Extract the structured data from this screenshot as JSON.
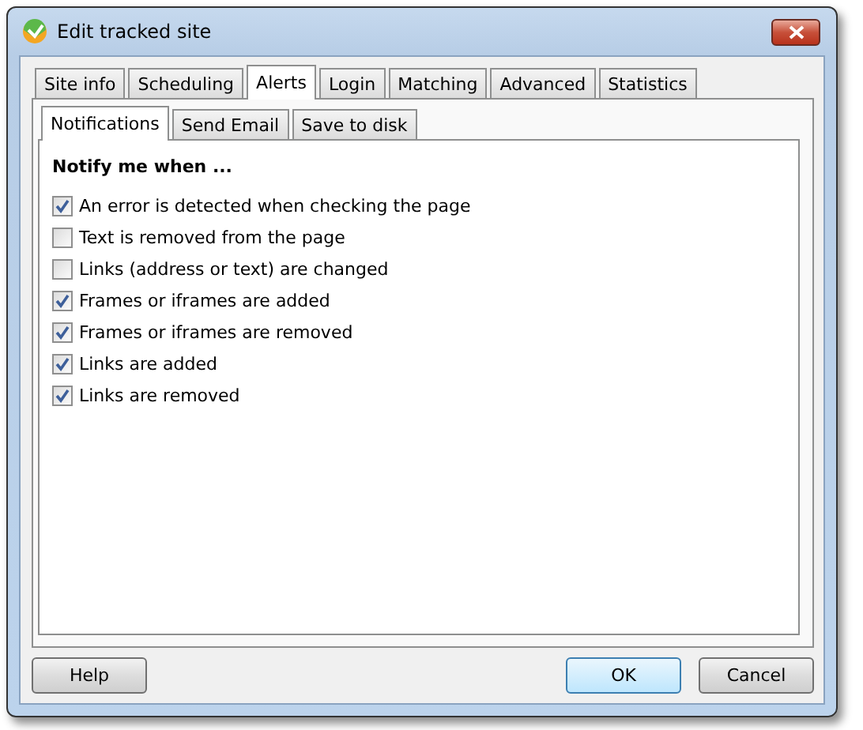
{
  "window": {
    "title": "Edit tracked site"
  },
  "tabs": [
    {
      "label": "Site info",
      "selected": false
    },
    {
      "label": "Scheduling",
      "selected": false
    },
    {
      "label": "Alerts",
      "selected": true
    },
    {
      "label": "Login",
      "selected": false
    },
    {
      "label": "Matching",
      "selected": false
    },
    {
      "label": "Advanced",
      "selected": false
    },
    {
      "label": "Statistics",
      "selected": false
    }
  ],
  "subtabs": [
    {
      "label": "Notifications",
      "selected": true
    },
    {
      "label": "Send Email",
      "selected": false
    },
    {
      "label": "Save to disk",
      "selected": false
    }
  ],
  "heading": "Notify me when ...",
  "options": [
    {
      "label": "An error is detected when checking the page",
      "checked": true
    },
    {
      "label": "Text is removed from the page",
      "checked": false
    },
    {
      "label": "Links (address or text) are changed",
      "checked": false
    },
    {
      "label": "Frames or iframes are added",
      "checked": true
    },
    {
      "label": "Frames or iframes are removed",
      "checked": true
    },
    {
      "label": "Links are added",
      "checked": true
    },
    {
      "label": "Links are removed",
      "checked": true
    }
  ],
  "buttons": {
    "help": "Help",
    "ok": "OK",
    "cancel": "Cancel"
  }
}
